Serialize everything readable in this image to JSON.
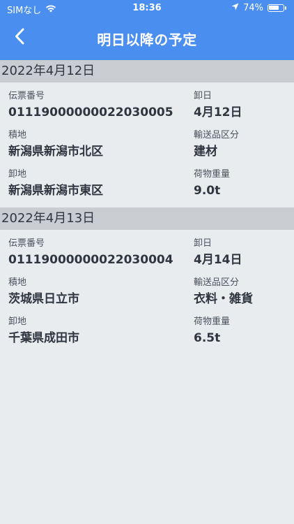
{
  "status_bar": {
    "carrier": "SIMなし",
    "time": "18:36",
    "battery": "74%",
    "battery_level": 0.74,
    "icons": [
      "wifi-icon",
      "location-arrow-icon",
      "battery-icon"
    ]
  },
  "nav": {
    "title": "明日以降の予定",
    "back_icon": "chevron-left-icon"
  },
  "sections": [
    {
      "date": "2022年4月12日",
      "slip_number_label": "伝票番号",
      "slip_number": "01119000000022030005",
      "unload_date_label": "卸日",
      "unload_date": "4月12日",
      "loading_place_label": "積地",
      "loading_place": "新潟県新潟市北区",
      "category_label": "輸送品区分",
      "category": "建材",
      "unloading_place_label": "卸地",
      "unloading_place": "新潟県新潟市東区",
      "weight_label": "荷物重量",
      "weight": "9.0t"
    },
    {
      "date": "2022年4月13日",
      "slip_number_label": "伝票番号",
      "slip_number": "01119000000022030004",
      "unload_date_label": "卸日",
      "unload_date": "4月14日",
      "loading_place_label": "積地",
      "loading_place": "茨城県日立市",
      "category_label": "輸送品区分",
      "category": "衣料・雑貨",
      "unloading_place_label": "卸地",
      "unloading_place": "千葉県成田市",
      "weight_label": "荷物重量",
      "weight": "6.5t"
    }
  ],
  "colors": {
    "header_blue": "#4a8ef0",
    "date_band": "#c9ccd1",
    "background": "#e9ecef",
    "text": "#2f3640"
  }
}
